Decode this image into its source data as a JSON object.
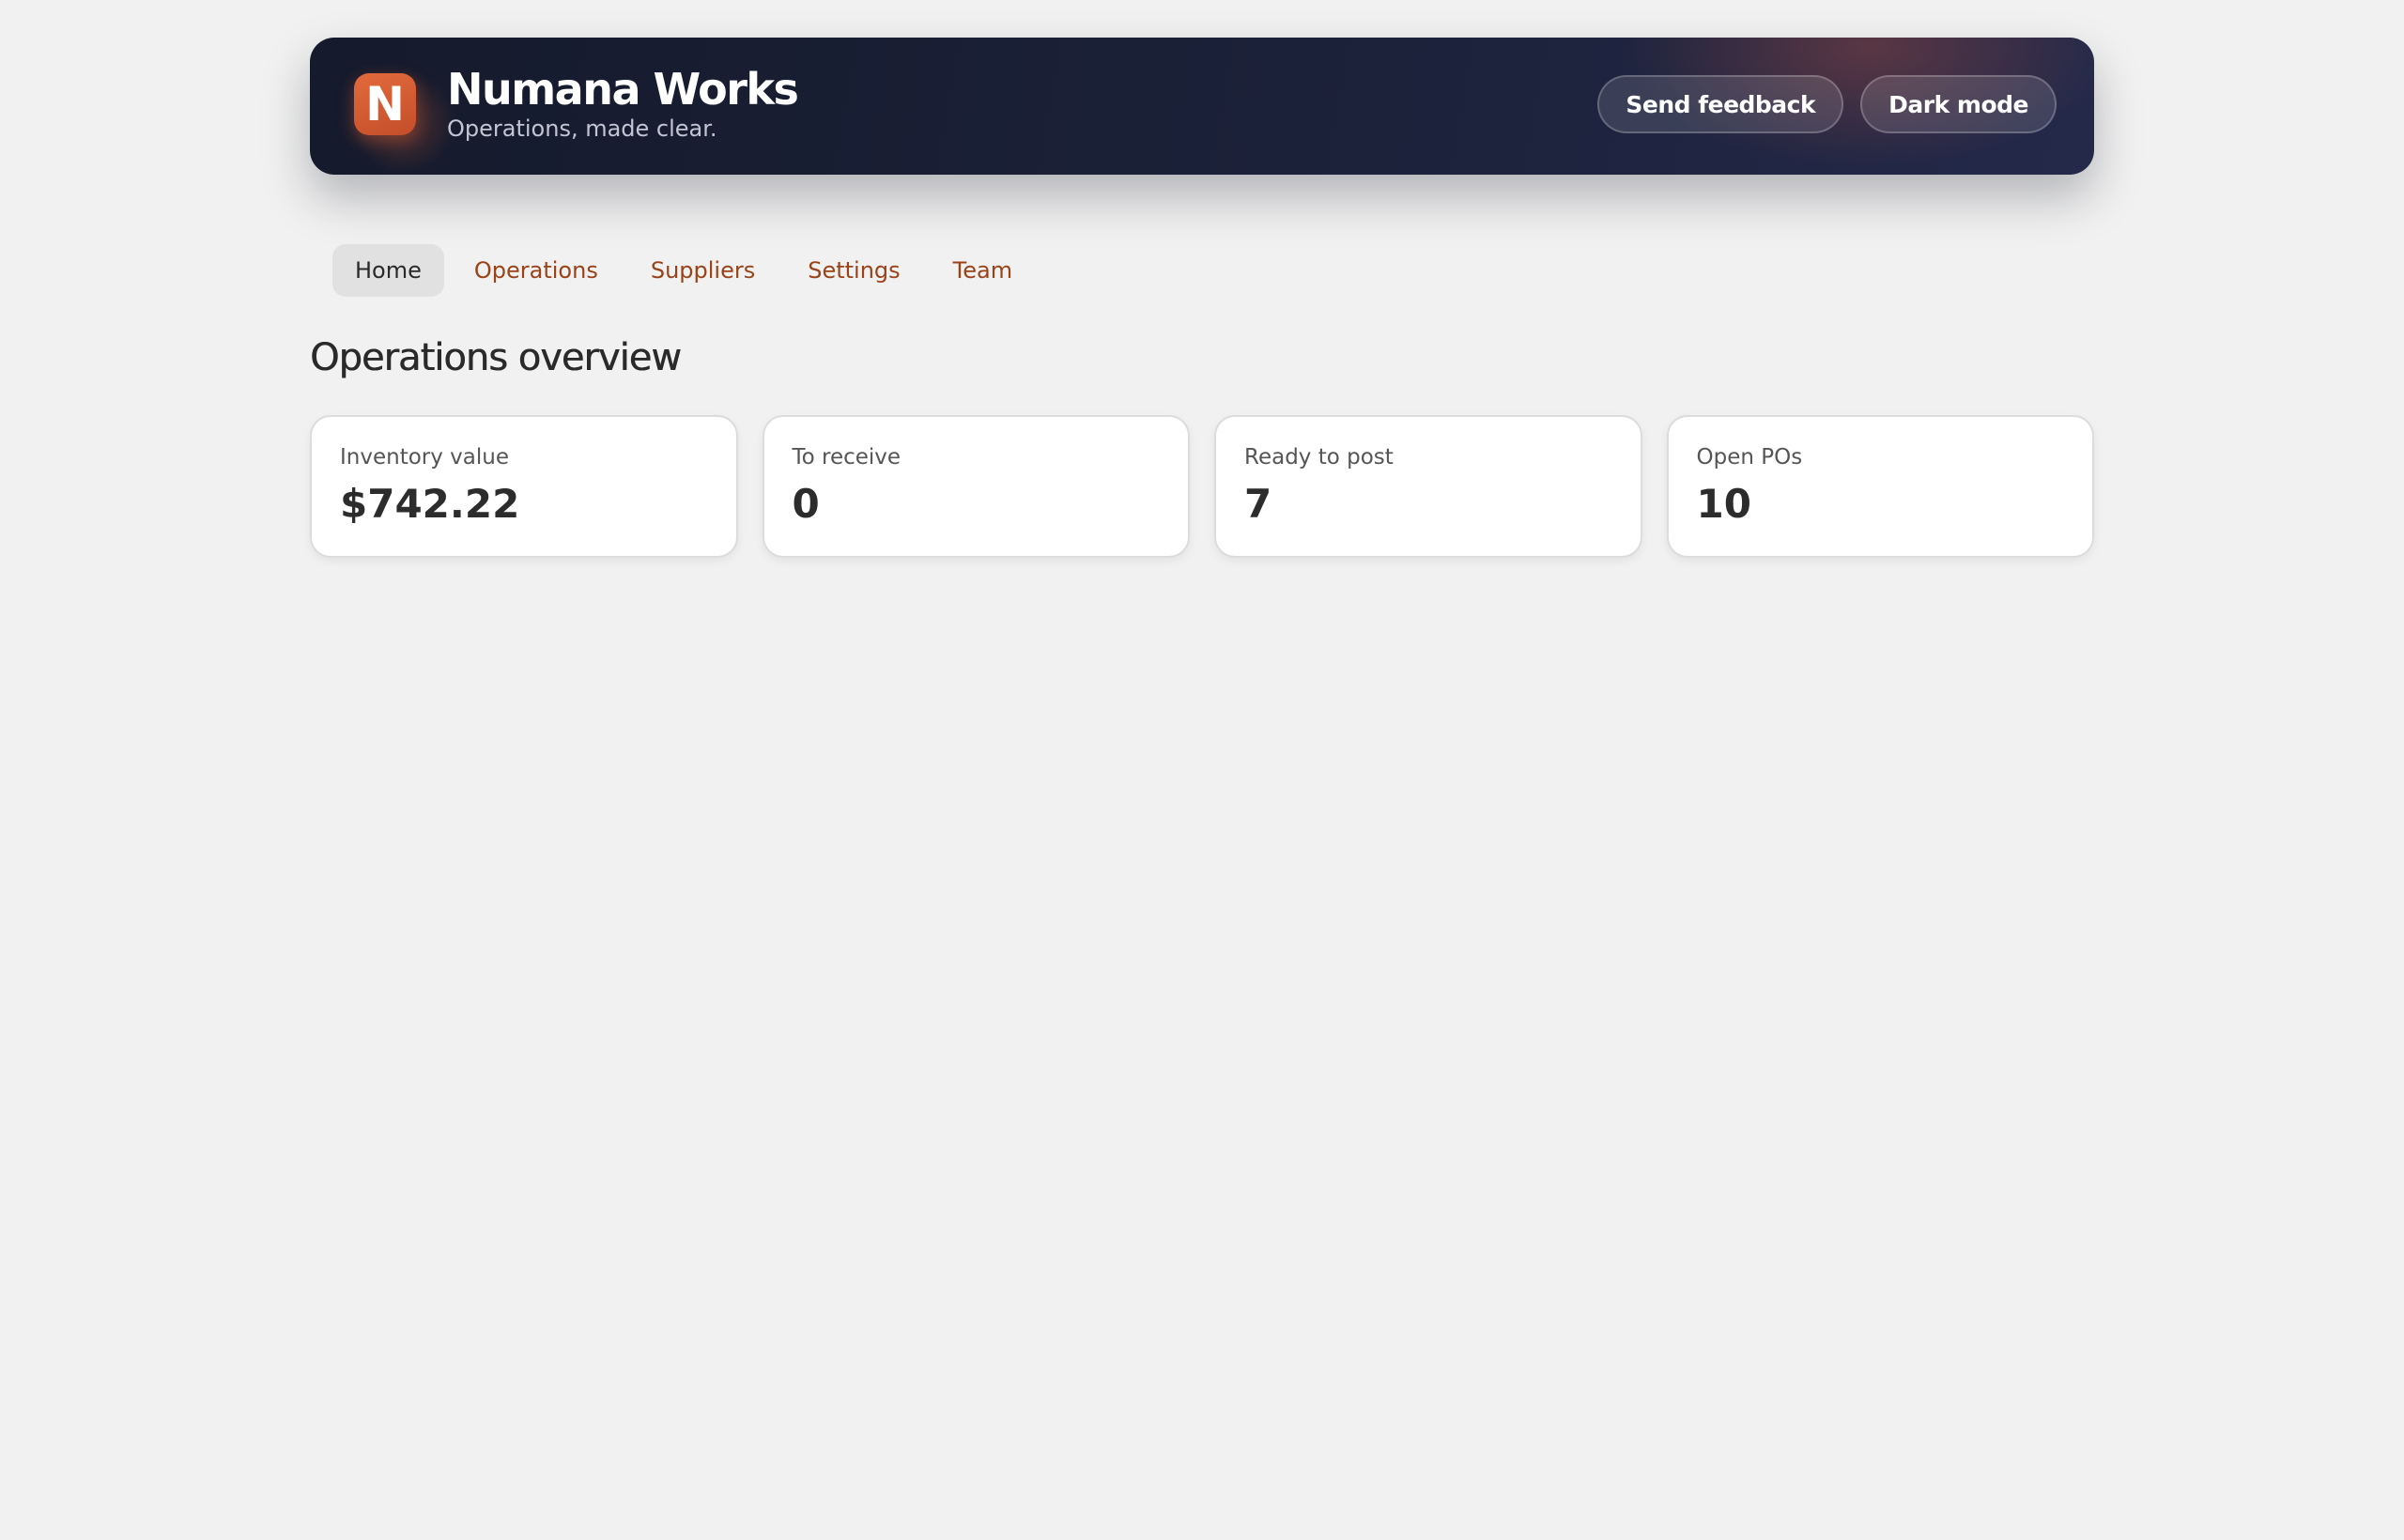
{
  "header": {
    "logo_letter": "N",
    "brand_name": "Numana Works",
    "tagline": "Operations, made clear.",
    "actions": {
      "feedback_label": "Send feedback",
      "dark_mode_label": "Dark mode"
    }
  },
  "nav": {
    "items": [
      {
        "label": "Home",
        "active": true
      },
      {
        "label": "Operations",
        "active": false
      },
      {
        "label": "Suppliers",
        "active": false
      },
      {
        "label": "Settings",
        "active": false
      },
      {
        "label": "Team",
        "active": false
      }
    ]
  },
  "main": {
    "title": "Operations overview",
    "stats": [
      {
        "label": "Inventory value",
        "value": "$742.22"
      },
      {
        "label": "To receive",
        "value": "0"
      },
      {
        "label": "Ready to post",
        "value": "7"
      },
      {
        "label": "Open POs",
        "value": "10"
      }
    ]
  },
  "colors": {
    "background": "#f1f1f1",
    "header_bg": "#1b2138",
    "accent": "#d95f35",
    "nav_link": "#9a4218",
    "nav_active_bg": "#e1e1e1"
  }
}
